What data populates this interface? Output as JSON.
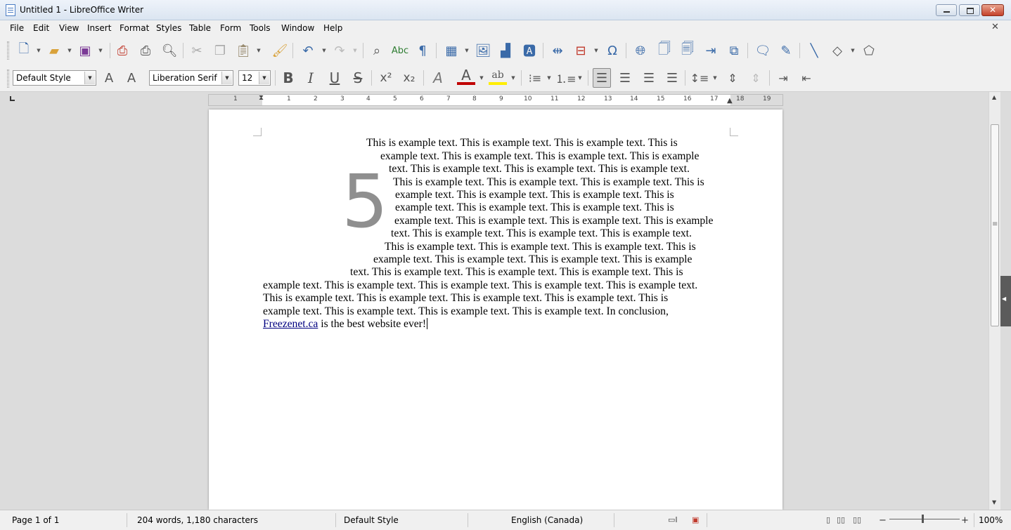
{
  "window": {
    "title": "Untitled 1 - LibreOffice Writer"
  },
  "menu": {
    "items": [
      "File",
      "Edit",
      "View",
      "Insert",
      "Format",
      "Styles",
      "Table",
      "Form",
      "Tools",
      "Window",
      "Help"
    ]
  },
  "toolbar_standard": {
    "icons": [
      "new-document",
      "open",
      "save",
      "export-pdf",
      "print",
      "print-preview",
      "cut",
      "copy",
      "paste",
      "clone-formatting",
      "undo",
      "redo",
      "find-replace",
      "spelling",
      "formatting-marks",
      "insert-table",
      "insert-image",
      "insert-chart",
      "insert-text-box",
      "page-break",
      "insert-field",
      "special-character",
      "hyperlink",
      "footnote",
      "endnote",
      "bookmark",
      "cross-reference",
      "comment",
      "track-changes",
      "line",
      "basic-shapes",
      "draw-functions"
    ]
  },
  "toolbar_formatting": {
    "paragraph_style": "Default Style",
    "font_name": "Liberation Serif",
    "font_size": "12",
    "bold": "B",
    "italic": "I",
    "underline": "U",
    "strikethrough": "S",
    "alignment_active": "left"
  },
  "ruler": {
    "numbers": [
      "1",
      "1",
      "2",
      "3",
      "4",
      "5",
      "6",
      "7",
      "8",
      "9",
      "10",
      "11",
      "12",
      "13",
      "14",
      "15",
      "16",
      "17",
      "18",
      "19"
    ]
  },
  "document": {
    "drop_cap": "5",
    "lines": [
      "This is example text.  This is example text.  This is example text.  This is",
      "example text.  This is example text.  This is example text.  This is example",
      "text.  This is example text.  This is example text.  This is example text.",
      "This is example text.  This is example text.  This is example text.  This is",
      "example text.  This is example text.  This is example text.  This is",
      "example text.  This is example text.  This is example text.  This is",
      "example text.  This is example text.  This is example text.  This is example",
      "text.  This is example text.  This is example text.  This is example text.",
      "This is example text.  This is example text.  This is example text.  This is",
      "example text.  This is example text.  This is example text.  This is example",
      "text.  This is example text.  This is example text.  This is example text.  This is",
      "example text.  This is example text.  This is example text.  This is example text.  This is example text.",
      "This is example text.  This is example text.  This is example text.  This is example text.  This is",
      "example text.  This is example text.  This is example text.  This is example text.  In conclusion,"
    ],
    "last_line_link": "Freezenet.ca",
    "last_line_rest": " is the best website ever!"
  },
  "statusbar": {
    "page": "Page 1 of 1",
    "word_count": "204 words, 1,180 characters",
    "page_style": "Default Style",
    "language": "English (Canada)",
    "zoom": "100%"
  }
}
